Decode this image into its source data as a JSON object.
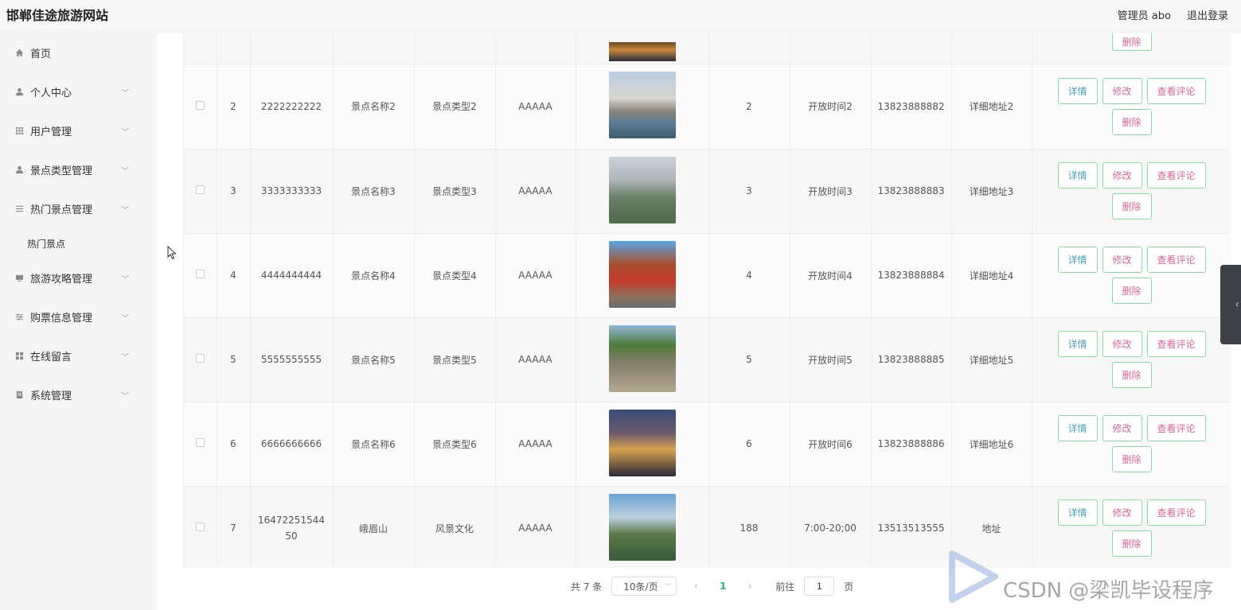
{
  "header": {
    "title": "邯郸佳途旅游网站",
    "user": "管理员 abo",
    "logout": "退出登录"
  },
  "sidebar": {
    "items": [
      {
        "label": "首页",
        "icon": "home-icon",
        "chevron": false
      },
      {
        "label": "个人中心",
        "icon": "user-icon",
        "chevron": true
      },
      {
        "label": "用户管理",
        "icon": "grid-icon",
        "chevron": true
      },
      {
        "label": "景点类型管理",
        "icon": "user-icon",
        "chevron": true
      },
      {
        "label": "热门景点管理",
        "icon": "list-icon",
        "chevron": true,
        "sub": [
          "热门景点"
        ]
      },
      {
        "label": "旅游攻略管理",
        "icon": "monitor-icon",
        "chevron": true
      },
      {
        "label": "购票信息管理",
        "icon": "sliders-icon",
        "chevron": true
      },
      {
        "label": "在线留言",
        "icon": "grid-icon",
        "chevron": true
      },
      {
        "label": "系统管理",
        "icon": "doc-icon",
        "chevron": true
      }
    ]
  },
  "table": {
    "buttons": {
      "detail": "详情",
      "edit": "修改",
      "review": "查看评论",
      "delete": "删除"
    },
    "rows": [
      {
        "idx": "2",
        "code": "2222222222",
        "name": "景点名称2",
        "type": "景点类型2",
        "level": "AAAAA",
        "img": "img-2",
        "count": "2",
        "hours": "开放时间2",
        "phone": "13823888882",
        "addr": "详细地址2"
      },
      {
        "idx": "3",
        "code": "3333333333",
        "name": "景点名称3",
        "type": "景点类型3",
        "level": "AAAAA",
        "img": "img-3",
        "count": "3",
        "hours": "开放时间3",
        "phone": "13823888883",
        "addr": "详细地址3"
      },
      {
        "idx": "4",
        "code": "4444444444",
        "name": "景点名称4",
        "type": "景点类型4",
        "level": "AAAAA",
        "img": "img-4",
        "count": "4",
        "hours": "开放时间4",
        "phone": "13823888884",
        "addr": "详细地址4"
      },
      {
        "idx": "5",
        "code": "5555555555",
        "name": "景点名称5",
        "type": "景点类型5",
        "level": "AAAAA",
        "img": "img-5",
        "count": "5",
        "hours": "开放时间5",
        "phone": "13823888885",
        "addr": "详细地址5"
      },
      {
        "idx": "6",
        "code": "6666666666",
        "name": "景点名称6",
        "type": "景点类型6",
        "level": "AAAAA",
        "img": "img-6",
        "count": "6",
        "hours": "开放时间6",
        "phone": "13823888886",
        "addr": "详细地址6"
      },
      {
        "idx": "7",
        "code": "1647225154450",
        "name": "峨眉山",
        "type": "风景文化",
        "level": "AAAAA",
        "img": "img-7",
        "count": "188",
        "hours": "7:00-20;00",
        "phone": "13513513555",
        "addr": "地址"
      }
    ]
  },
  "pagination": {
    "total": "共 7 条",
    "page_size": "10条/页",
    "current": "1",
    "goto_label": "前往",
    "goto_value": "1",
    "page_unit": "页"
  },
  "watermark": {
    "text": "CSDN @梁凯毕设程序"
  },
  "colors": {
    "accent": "#1fb27a",
    "btn_border": "#8fd9a8",
    "btn_blue": "#4aa0b8",
    "btn_pink": "#d1689a"
  }
}
